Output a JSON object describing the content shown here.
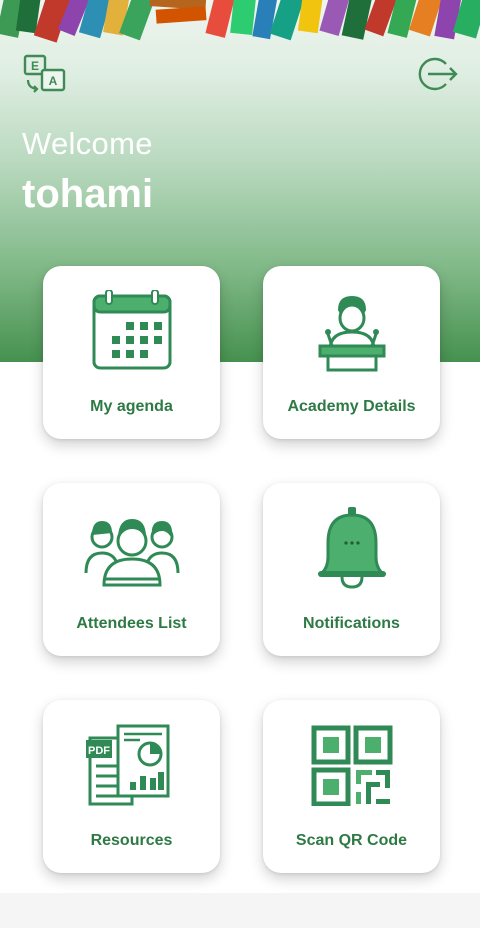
{
  "header": {
    "welcome": "Welcome",
    "username": "tohami",
    "language_icon": "language-switch-icon",
    "logout_icon": "logout-icon"
  },
  "menu": [
    {
      "label": "My agenda",
      "icon": "calendar-icon"
    },
    {
      "label": "Academy Details",
      "icon": "speaker-podium-icon"
    },
    {
      "label": "Attendees List",
      "icon": "people-group-icon"
    },
    {
      "label": "Notifications",
      "icon": "bell-icon"
    },
    {
      "label": "Resources",
      "icon": "documents-icon"
    },
    {
      "label": "Scan QR Code",
      "icon": "qr-code-icon"
    }
  ],
  "colors": {
    "accent": "#2e7a45",
    "icon_green": "#2f8a55",
    "hero_bottom": "#46914f"
  }
}
